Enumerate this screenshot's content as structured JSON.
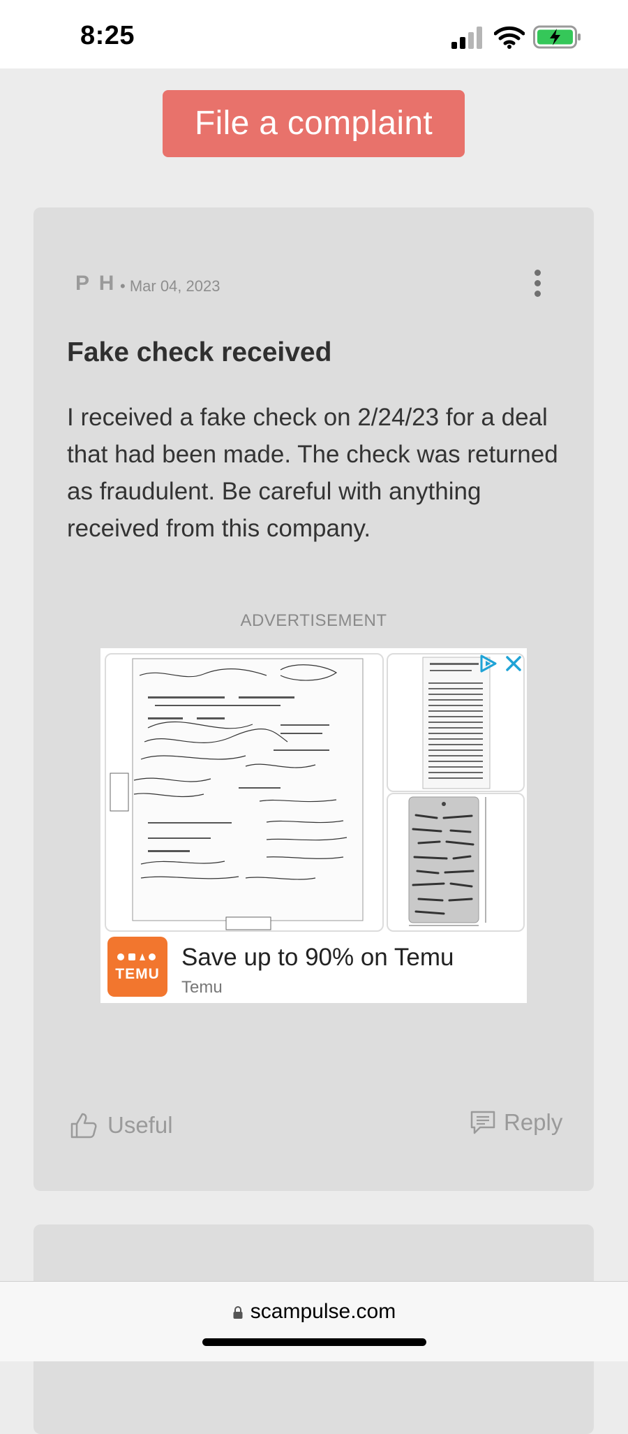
{
  "status_bar": {
    "time": "8:25"
  },
  "complaint_button": {
    "label": "File a complaint",
    "color": "#e8726b"
  },
  "review": {
    "author": "P H",
    "date": "• Mar 04, 2023",
    "title": "Fake check received",
    "body": "I received a fake check on 2/24/23 for a deal that had been made. The check was returned as fraudulent. Be careful with anything received from this company.",
    "ad": {
      "label": "ADVERTISEMENT",
      "headline": "Save up to 90% on Temu",
      "brand": "Temu",
      "logo_text": "TEMU",
      "logo_color": "#f2762e"
    },
    "actions": {
      "useful_label": "Useful",
      "reply_label": "Reply"
    }
  },
  "browser": {
    "url": "scampulse.com"
  }
}
